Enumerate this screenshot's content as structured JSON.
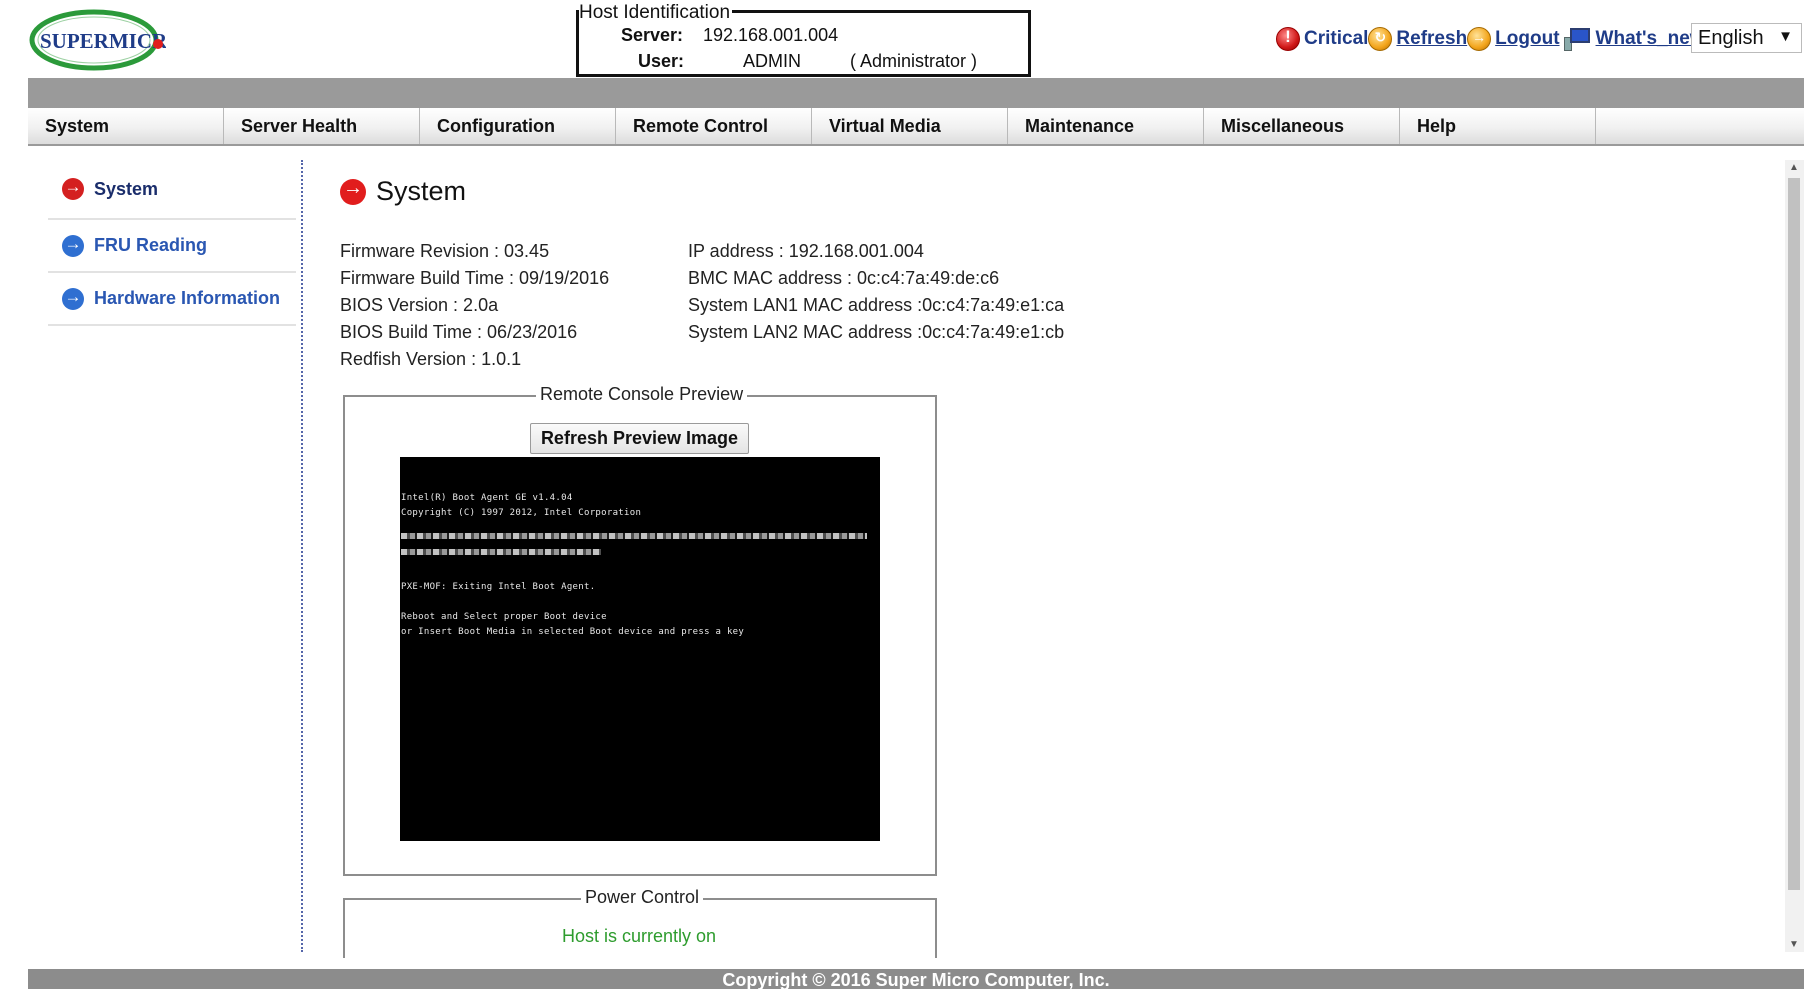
{
  "brand": {
    "logo_text": "SUPERMICRO"
  },
  "host": {
    "legend": "Host Identification",
    "server_label": "Server:",
    "server_value": "192.168.001.004",
    "user_label": "User:",
    "user_value": "ADMIN",
    "user_role": "( Administrator )"
  },
  "top_links": {
    "critical": "Critical",
    "refresh": "Refresh",
    "logout": "Logout",
    "whats_new": "What's_new",
    "language": "English"
  },
  "nav": [
    "System",
    "Server Health",
    "Configuration",
    "Remote Control",
    "Virtual Media",
    "Maintenance",
    "Miscellaneous",
    "Help"
  ],
  "sidebar": [
    {
      "label": "System"
    },
    {
      "label": "FRU Reading"
    },
    {
      "label": "Hardware Information"
    }
  ],
  "page_title": "System",
  "system_info": {
    "firmware_revision": "Firmware Revision : 03.45",
    "firmware_build_time": "Firmware Build Time : 09/19/2016",
    "bios_version": "BIOS Version : 2.0a",
    "bios_build_time": "BIOS Build Time : 06/23/2016",
    "redfish_version": "Redfish Version : 1.0.1",
    "ip_address": "IP address : 192.168.001.004",
    "bmc_mac": "BMC MAC address : 0c:c4:7a:49:de:c6",
    "lan1_mac": "System LAN1 MAC address :0c:c4:7a:49:e1:ca",
    "lan2_mac": "System LAN2 MAC address :0c:c4:7a:49:e1:cb"
  },
  "remote_console": {
    "legend": "Remote Console Preview",
    "refresh_button": "Refresh Preview Image",
    "lines": [
      "Intel(R) Boot Agent GE v1.4.04",
      "Copyright (C) 1997 2012, Intel Corporation",
      "PXE-MOF: Exiting Intel Boot Agent.",
      "Reboot and Select proper Boot device",
      "or Insert Boot Media in selected Boot device and press a key"
    ]
  },
  "power_control": {
    "legend": "Power Control",
    "status": "Host is currently on"
  },
  "footer": {
    "copyright": "Copyright © 2016 Super Micro Computer, Inc."
  },
  "colors": {
    "link_blue": "#1f3c88",
    "status_green": "#2e9c2e",
    "critical_red": "#d01818",
    "band_grey": "#9a9a9a"
  },
  "icons": {
    "critical": "critical-alert-icon",
    "refresh": "refresh-icon",
    "logout": "logout-icon",
    "whats_new": "monitor-icon",
    "sidebar_active": "red-arrow-circle-icon",
    "sidebar_inactive": "blue-arrow-circle-icon"
  }
}
